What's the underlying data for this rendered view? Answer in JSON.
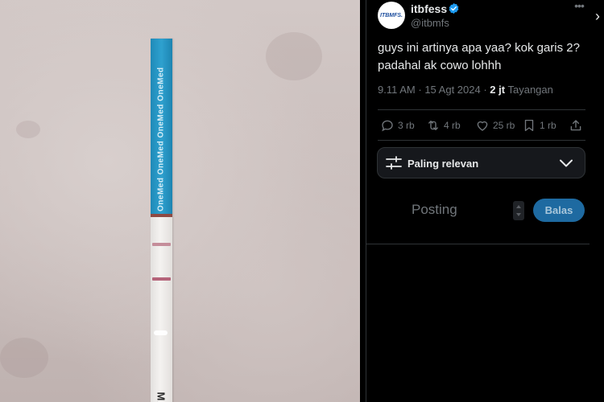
{
  "photo": {
    "strip_brand_text": "OneMed OneMed OneMed OneMed",
    "strip_bottom_text": "MAX"
  },
  "tweet": {
    "avatar_text": "ITBMFS.",
    "display_name": "itbfess",
    "handle": "@itbmfs",
    "text_line1": "guys ini artinya apa yaa? kok garis 2?",
    "text_line2": "padahal ak cowo lohhh",
    "time": "9.11 AM",
    "date": "15 Agt 2024",
    "views_count": "2 jt",
    "views_label": "Tayangan"
  },
  "actions": {
    "replies": "3 rb",
    "reposts": "4 rb",
    "likes": "25 rb",
    "bookmarks": "1 rb"
  },
  "sort": {
    "label": "Paling relevan"
  },
  "compose": {
    "placeholder": "Posting",
    "reply_button": "Balas"
  },
  "icons": {
    "more": "more-icon",
    "verified": "verified-badge-icon",
    "reply": "reply-icon",
    "repost": "repost-icon",
    "like": "heart-icon",
    "bookmark": "bookmark-icon",
    "share": "share-icon",
    "sort": "sliders-icon",
    "chevron": "chevron-down-icon",
    "next": "chevron-right-icon"
  },
  "colors": {
    "background": "#000000",
    "text_primary": "#e7e9ea",
    "text_secondary": "#71767b",
    "border": "#2f3336",
    "verified_blue": "#1d9bf0",
    "reply_button_bg": "#1e6aa1",
    "strip_blue": "#2ea1cf"
  }
}
